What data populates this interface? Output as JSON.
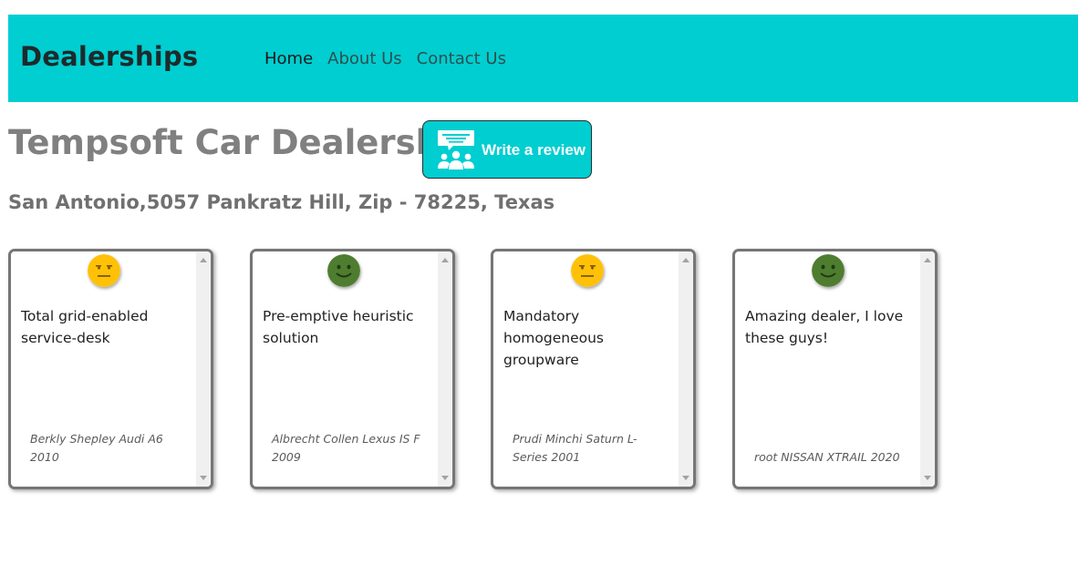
{
  "navbar": {
    "brand": "Dealerships",
    "links": [
      {
        "label": "Home"
      },
      {
        "label": "About Us"
      },
      {
        "label": "Contact Us"
      }
    ]
  },
  "dealer": {
    "title": "Tempsoft Car Dealership",
    "address": "San Antonio,5057 Pankratz Hill, Zip - 78225, Texas"
  },
  "write_review": {
    "label": "Write a review",
    "icon": "review-people-icon"
  },
  "colors": {
    "navbar_bg": "#00ced1",
    "neutral_face": "#ffc107",
    "positive_face": "#4e7d2f"
  },
  "reviews": [
    {
      "sentiment": "neutral",
      "text": "Total grid-enabled service-desk",
      "reviewer": "Berkly Shepley Audi A6 2010"
    },
    {
      "sentiment": "positive",
      "text": "Pre-emptive heuristic solution",
      "reviewer": "Albrecht Collen Lexus IS F 2009"
    },
    {
      "sentiment": "neutral",
      "text": "Mandatory homogeneous groupware",
      "reviewer": "Prudi Minchi Saturn L-Series 2001"
    },
    {
      "sentiment": "positive",
      "text": "Amazing dealer, I love these guys!",
      "reviewer": "root NISSAN XTRAIL 2020"
    }
  ]
}
